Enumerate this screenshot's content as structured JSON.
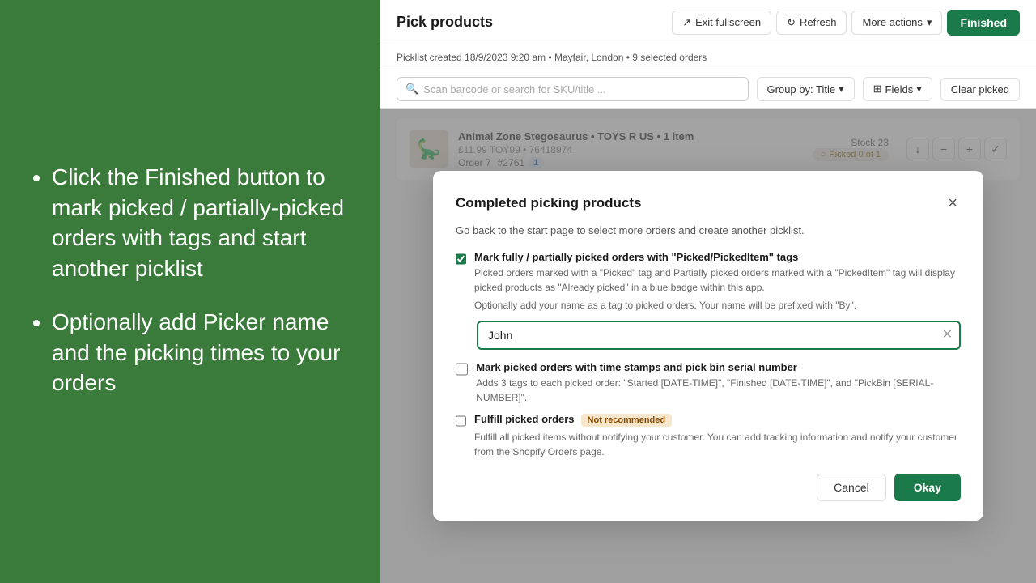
{
  "left_panel": {
    "bullets": [
      "Click the Finished button to mark picked / partially-picked orders with tags and start another picklist",
      "Optionally add Picker name and the picking times to your orders"
    ]
  },
  "top_bar": {
    "title": "Pick products",
    "exit_fullscreen": "Exit fullscreen",
    "refresh": "Refresh",
    "more_actions": "More actions",
    "finished": "Finished"
  },
  "sub_header": {
    "text": "Picklist created 18/9/2023 9:20 am • Mayfair, London • 9 selected orders"
  },
  "toolbar": {
    "search_placeholder": "Scan barcode or search for SKU/title ...",
    "group_by": "Group by: Title",
    "fields": "Fields",
    "clear_picked": "Clear picked"
  },
  "modal": {
    "title": "Completed picking products",
    "subtitle": "Go back to the start page to select more orders and create another picklist.",
    "close_label": "×",
    "checkbox1_label": "Mark fully / partially picked orders with \"Picked/PickedItem\" tags",
    "checkbox1_desc": "Picked orders marked with a \"Picked\" tag and Partially picked orders marked with a \"PickedItem\" tag will display picked products as \"Already picked\" in a blue badge within this app.",
    "checkbox1_desc2": "Optionally add your name as a tag to picked orders. Your name will be prefixed with \"By\".",
    "name_input_value": "John",
    "checkbox2_label": "Mark picked orders with time stamps and pick bin serial number",
    "checkbox2_desc": "Adds 3 tags to each picked order: \"Started [DATE-TIME]\", \"Finished [DATE-TIME]\", and \"PickBin [SERIAL-NUMBER]\".",
    "checkbox3_label": "Fulfill picked orders",
    "checkbox3_badge": "Not recommended",
    "checkbox3_desc": "Fulfill all picked items without notifying your customer. You can add tracking information and notify your customer from the Shopify Orders page.",
    "cancel_label": "Cancel",
    "okay_label": "Okay"
  },
  "products": [
    {
      "name": "Animal Zone Stegosaurus • TOYS R US • 1 item",
      "price": "£11.99",
      "sku": "TOY99 • 76418974",
      "order": "Order 7",
      "order_num": "#2761",
      "order_badge": "1",
      "stock": "Stock 23",
      "picked": "Picked 0 of 1",
      "emoji": "🦕"
    }
  ],
  "colors": {
    "green_bg": "#3a7a3a",
    "green_btn": "#1a7a4a",
    "accent_blue": "#1a6abf"
  }
}
